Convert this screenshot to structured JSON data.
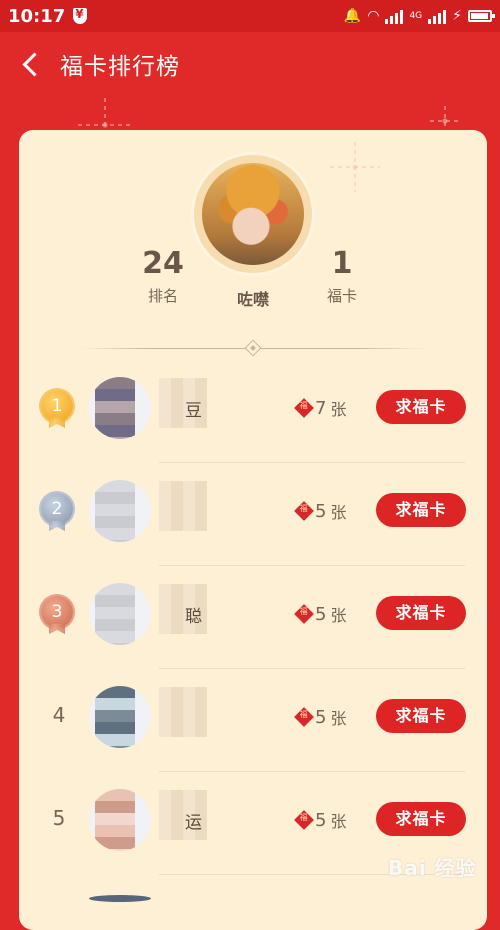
{
  "status_bar": {
    "time": "10:17",
    "network": "4G"
  },
  "nav": {
    "title": "福卡排行榜"
  },
  "profile": {
    "rank_value": "24",
    "rank_label": "排名",
    "name": "咗噤",
    "cards_value": "1",
    "cards_label": "福卡"
  },
  "leaderboard": [
    {
      "rank": "1",
      "name_fragment": "豆",
      "count": "7",
      "unit": "张",
      "button": "求福卡",
      "medal": "gold"
    },
    {
      "rank": "2",
      "name_fragment": "",
      "count": "5",
      "unit": "张",
      "button": "求福卡",
      "medal": "silver"
    },
    {
      "rank": "3",
      "name_fragment": "聪",
      "count": "5",
      "unit": "张",
      "button": "求福卡",
      "medal": "bronze"
    },
    {
      "rank": "4",
      "name_fragment": "",
      "count": "5",
      "unit": "张",
      "button": "求福卡",
      "medal": ""
    },
    {
      "rank": "5",
      "name_fragment": "运",
      "count": "5",
      "unit": "张",
      "button": "求福卡",
      "medal": ""
    }
  ],
  "watermark": "Bai 经验",
  "colors": {
    "brand_red": "#e02a2a",
    "card_bg": "#fdf0d5",
    "button_red": "#dd2525"
  }
}
